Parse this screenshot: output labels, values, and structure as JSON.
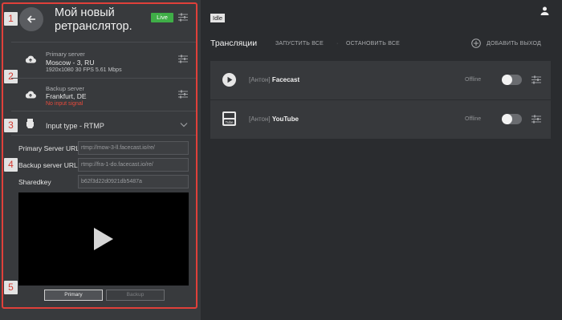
{
  "left_panel": {
    "markers": [
      "1",
      "2",
      "3",
      "4",
      "5"
    ],
    "title": "Мой новый ретранслятор.",
    "live_badge": "Live",
    "primary_server": {
      "label": "Primary server",
      "location": "Moscow - 3, RU",
      "meta": "1920x1080 30 FPS 5.61 Mbps"
    },
    "backup_server": {
      "label": "Backup server",
      "location": "Frankfurt, DE",
      "error": "No input signal"
    },
    "input_type": "Input type - RTMP",
    "fields": [
      {
        "label": "Primary Server URL",
        "value": "rtmp://mow-3-ll.facecast.io/re/"
      },
      {
        "label": "Backup server URL",
        "value": "rtmp://fra-1-do.facecast.io/re/"
      },
      {
        "label": "Sharedkey",
        "value": "b62f3d22d0921db5487a"
      }
    ],
    "source_buttons": {
      "primary": "Primary",
      "backup": "Backup"
    }
  },
  "header": {
    "status_badge": "Idle"
  },
  "toolbar": {
    "title": "Трансляции",
    "start_all": "ЗАПУСТИТЬ ВСЕ",
    "stop_all": "ОСТАНОВИТЬ ВСЕ",
    "add_output": "ДОБАВИТЬ ВЫХОД"
  },
  "streams": [
    {
      "owner": "[Антон]",
      "name": "Facecast",
      "status": "Offline",
      "icon": "play-circle-icon"
    },
    {
      "owner": "[Антон]",
      "name": "YouTube",
      "status": "Offline",
      "icon": "youtube-icon"
    }
  ],
  "colors": {
    "live": "#3fae47",
    "error": "#e64a3c",
    "annotation": "#e0403a"
  }
}
